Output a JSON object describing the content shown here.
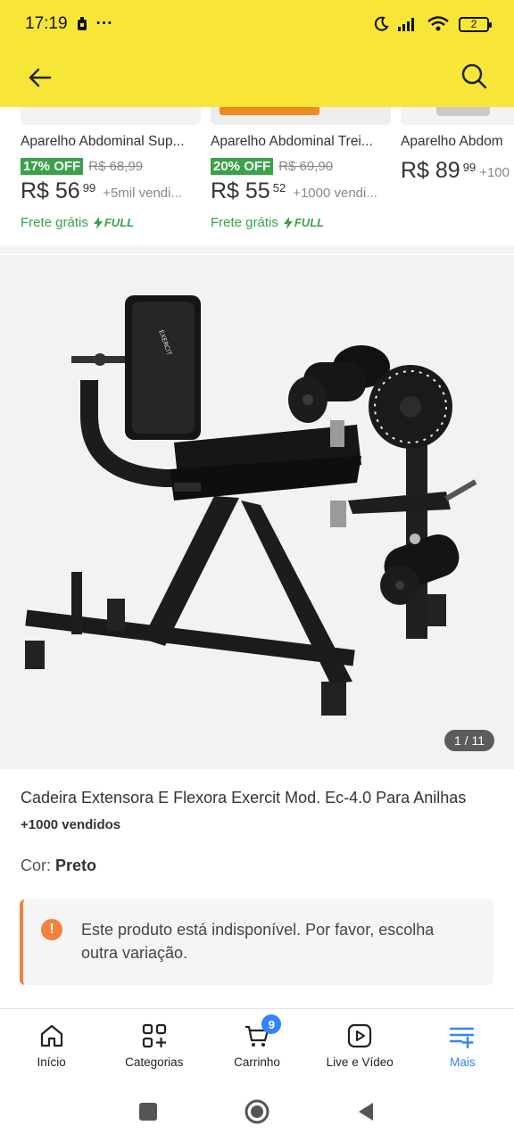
{
  "status_bar": {
    "time": "17:19",
    "dots": "···",
    "battery": "2"
  },
  "nav": {
    "back_icon": "arrow-left-icon",
    "search_icon": "search-icon"
  },
  "recommendations": [
    {
      "title": "Aparelho Abdominal Sup...",
      "discount": "17% OFF",
      "old_price": "R$ 68,99",
      "price": "R$ 56",
      "cents": "99",
      "sold": "+5mil vendi...",
      "shipping": "Frete grátis",
      "full": "FULL"
    },
    {
      "title": "Aparelho Abdominal Trei...",
      "discount": "20% OFF",
      "old_price": "R$ 69,90",
      "price": "R$ 55",
      "cents": "52",
      "sold": "+1000 vendi...",
      "shipping": "Frete grátis",
      "full": "FULL"
    },
    {
      "title": "Aparelho Abdom",
      "price": "R$ 89",
      "cents": "99",
      "sold": "+100"
    }
  ],
  "gallery": {
    "counter": "1 / 11"
  },
  "product": {
    "title": "Cadeira Extensora E Flexora Exercit Mod. Ec-4.0 Para Anilhas",
    "sold": "+1000 vendidos",
    "color_label": "Cor:",
    "color_value": "Preto"
  },
  "alert": {
    "icon": "!",
    "text": "Este produto está indisponível. Por favor, escolha outra variação."
  },
  "tabbar": {
    "items": [
      {
        "label": "Início",
        "icon": "home-icon"
      },
      {
        "label": "Categorias",
        "icon": "categories-icon"
      },
      {
        "label": "Carrinho",
        "icon": "cart-icon",
        "badge": "9"
      },
      {
        "label": "Live e Vídeo",
        "icon": "play-icon"
      },
      {
        "label": "Mais",
        "icon": "menu-plus-icon",
        "active": true
      }
    ]
  },
  "colors": {
    "header": "#f7e637",
    "accent": "#3483fa",
    "discount": "#39a24a",
    "warning": "#f0823c"
  }
}
